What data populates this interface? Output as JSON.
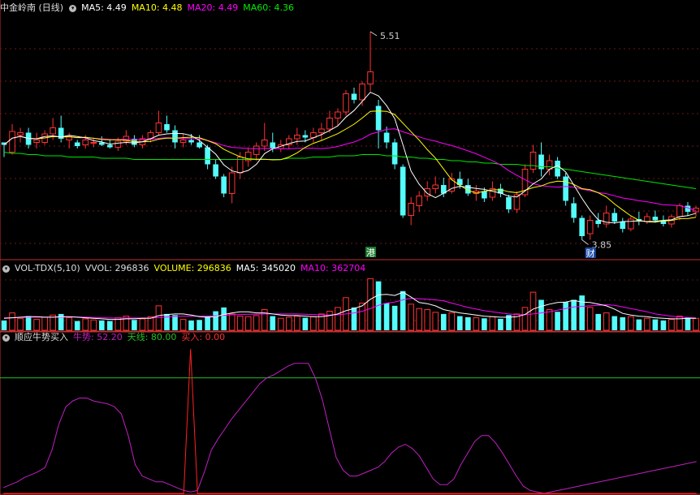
{
  "colors": {
    "bg": "#000000",
    "up": "#ff3232",
    "down": "#54fcfc",
    "ma5": "#ffffff",
    "ma10": "#ffff00",
    "ma20": "#ff00ff",
    "ma60": "#00e600",
    "panel_line": "#c03030",
    "osc_line": "#c020c0",
    "buy_line": "#ff2020",
    "tianxian": "#22c022"
  },
  "header": {
    "stock": "中金岭南 (日线)",
    "ma5_label": "MA5: 4.49",
    "ma10_label": "MA10: 4.48",
    "ma20_label": "MA20: 4.49",
    "ma60_label": "MA60: 4.36"
  },
  "vol_header": {
    "name": "VOL-TDX(5,10)",
    "vvol": "VVOL: 296836",
    "volume": "VOLUME: 296836",
    "ma5": "MA5: 345020",
    "ma10": "MA10: 362704"
  },
  "osc_header": {
    "name": "顺应牛势买入",
    "niushi": "牛势: 52.20",
    "tianxian": "天线: 80.00",
    "mairu": "买入: 0.00"
  },
  "annotations": {
    "high": "5.51",
    "low": "3.85",
    "marker_hk": "港",
    "marker_fin": "财"
  },
  "chart_data": {
    "type": "candlestick",
    "price_range": [
      3.65,
      5.65
    ],
    "candles": [
      [
        4.6,
        4.6,
        4.48,
        4.58
      ],
      [
        4.52,
        4.75,
        4.5,
        4.69
      ],
      [
        4.66,
        4.72,
        4.6,
        4.68
      ],
      [
        4.68,
        4.72,
        4.55,
        4.58
      ],
      [
        4.6,
        4.68,
        4.55,
        4.62
      ],
      [
        4.6,
        4.7,
        4.58,
        4.67
      ],
      [
        4.67,
        4.8,
        4.62,
        4.72
      ],
      [
        4.72,
        4.82,
        4.6,
        4.63
      ],
      [
        4.62,
        4.68,
        4.55,
        4.65
      ],
      [
        4.6,
        4.62,
        4.55,
        4.57
      ],
      [
        4.58,
        4.66,
        4.55,
        4.62
      ],
      [
        4.6,
        4.63,
        4.56,
        4.6
      ],
      [
        4.6,
        4.65,
        4.57,
        4.58
      ],
      [
        4.58,
        4.62,
        4.55,
        4.56
      ],
      [
        4.56,
        4.64,
        4.53,
        4.61
      ],
      [
        4.61,
        4.7,
        4.58,
        4.65
      ],
      [
        4.63,
        4.66,
        4.56,
        4.58
      ],
      [
        4.58,
        4.66,
        4.55,
        4.63
      ],
      [
        4.63,
        4.7,
        4.6,
        4.68
      ],
      [
        4.68,
        4.86,
        4.66,
        4.76
      ],
      [
        4.75,
        4.82,
        4.68,
        4.7
      ],
      [
        4.7,
        4.74,
        4.55,
        4.6
      ],
      [
        4.6,
        4.67,
        4.56,
        4.62
      ],
      [
        4.62,
        4.67,
        4.58,
        4.6
      ],
      [
        4.6,
        4.66,
        4.55,
        4.56
      ],
      [
        4.56,
        4.58,
        4.38,
        4.42
      ],
      [
        4.42,
        4.46,
        4.3,
        4.32
      ],
      [
        4.32,
        4.34,
        4.15,
        4.18
      ],
      [
        4.18,
        4.4,
        4.1,
        4.35
      ],
      [
        4.35,
        4.52,
        4.3,
        4.48
      ],
      [
        4.45,
        4.56,
        4.4,
        4.52
      ],
      [
        4.5,
        4.6,
        4.45,
        4.57
      ],
      [
        4.57,
        4.76,
        4.53,
        4.62
      ],
      [
        4.6,
        4.68,
        4.52,
        4.55
      ],
      [
        4.55,
        4.62,
        4.52,
        4.58
      ],
      [
        4.58,
        4.66,
        4.55,
        4.63
      ],
      [
        4.63,
        4.72,
        4.58,
        4.66
      ],
      [
        4.66,
        4.7,
        4.6,
        4.64
      ],
      [
        4.64,
        4.72,
        4.6,
        4.68
      ],
      [
        4.68,
        4.76,
        4.62,
        4.71
      ],
      [
        4.71,
        4.86,
        4.68,
        4.8
      ],
      [
        4.8,
        4.88,
        4.74,
        4.85
      ],
      [
        4.85,
        5.03,
        4.82,
        5.0
      ],
      [
        5.0,
        5.05,
        4.92,
        4.95
      ],
      [
        4.95,
        5.1,
        4.9,
        5.08
      ],
      [
        5.08,
        5.51,
        5.02,
        5.18
      ],
      [
        4.9,
        4.95,
        4.55,
        4.7
      ],
      [
        4.68,
        4.73,
        4.55,
        4.6
      ],
      [
        4.6,
        4.63,
        4.38,
        4.42
      ],
      [
        4.4,
        4.42,
        3.98,
        4.0
      ],
      [
        4.0,
        4.15,
        3.92,
        4.1
      ],
      [
        4.08,
        4.2,
        4.03,
        4.16
      ],
      [
        4.16,
        4.28,
        4.12,
        4.22
      ],
      [
        4.22,
        4.32,
        4.18,
        4.25
      ],
      [
        4.25,
        4.31,
        4.15,
        4.18
      ],
      [
        4.2,
        4.35,
        4.18,
        4.3
      ],
      [
        4.3,
        4.36,
        4.22,
        4.25
      ],
      [
        4.25,
        4.3,
        4.16,
        4.18
      ],
      [
        4.18,
        4.25,
        4.12,
        4.2
      ],
      [
        4.2,
        4.23,
        4.11,
        4.14
      ],
      [
        4.15,
        4.28,
        4.12,
        4.22
      ],
      [
        4.22,
        4.26,
        4.15,
        4.18
      ],
      [
        4.15,
        4.17,
        4.02,
        4.05
      ],
      [
        4.05,
        4.2,
        4.02,
        4.17
      ],
      [
        4.17,
        4.42,
        4.15,
        4.38
      ],
      [
        4.38,
        4.58,
        4.35,
        4.52
      ],
      [
        4.5,
        4.6,
        4.32,
        4.38
      ],
      [
        4.38,
        4.5,
        4.33,
        4.45
      ],
      [
        4.45,
        4.48,
        4.3,
        4.32
      ],
      [
        4.32,
        4.35,
        4.08,
        4.12
      ],
      [
        4.1,
        4.15,
        3.94,
        3.98
      ],
      [
        3.98,
        4.0,
        3.8,
        3.83
      ],
      [
        3.85,
        4.0,
        3.8,
        3.96
      ],
      [
        3.96,
        4.02,
        3.9,
        3.93
      ],
      [
        3.93,
        4.08,
        3.9,
        4.02
      ],
      [
        4.02,
        4.06,
        3.93,
        3.95
      ],
      [
        3.95,
        3.98,
        3.86,
        3.89
      ],
      [
        3.89,
        3.99,
        3.87,
        3.97
      ],
      [
        3.97,
        4.03,
        3.92,
        3.95
      ],
      [
        3.95,
        4.02,
        3.93,
        3.99
      ],
      [
        3.99,
        4.04,
        3.94,
        3.96
      ],
      [
        3.96,
        4.0,
        3.91,
        3.93
      ],
      [
        3.93,
        4.01,
        3.9,
        3.99
      ],
      [
        3.99,
        4.1,
        3.96,
        4.08
      ],
      [
        4.08,
        4.11,
        4.0,
        4.03
      ],
      [
        4.03,
        4.08,
        3.99,
        4.06
      ]
    ],
    "ma60": [
      4.52,
      4.51,
      4.51,
      4.5,
      4.5,
      4.49,
      4.49,
      4.49,
      4.48,
      4.48,
      4.48,
      4.48,
      4.47,
      4.47,
      4.47,
      4.47,
      4.46,
      4.46,
      4.46,
      4.46,
      4.46,
      4.46,
      4.46,
      4.46,
      4.46,
      4.46,
      4.46,
      4.46,
      4.46,
      4.46,
      4.46,
      4.46,
      4.46,
      4.46,
      4.46,
      4.47,
      4.47,
      4.47,
      4.48,
      4.48,
      4.48,
      4.49,
      4.49,
      4.49,
      4.5,
      4.5,
      4.5,
      4.49,
      4.49,
      4.48,
      4.48,
      4.47,
      4.47,
      4.46,
      4.46,
      4.45,
      4.45,
      4.44,
      4.44,
      4.43,
      4.43,
      4.42,
      4.42,
      4.42,
      4.41,
      4.41,
      4.4,
      4.4,
      4.39,
      4.38,
      4.37,
      4.36,
      4.35,
      4.34,
      4.33,
      4.32,
      4.31,
      4.3,
      4.29,
      4.28,
      4.27,
      4.26,
      4.25,
      4.24,
      4.23,
      4.22
    ],
    "volume_range": [
      0,
      1000000
    ],
    "volumes": [
      180000,
      320000,
      220000,
      260000,
      200000,
      240000,
      280000,
      300000,
      230000,
      170000,
      210000,
      190000,
      180000,
      170000,
      230000,
      260000,
      190000,
      210000,
      250000,
      450000,
      300000,
      280000,
      200000,
      180000,
      190000,
      260000,
      350000,
      420000,
      300000,
      260000,
      250000,
      270000,
      380000,
      260000,
      220000,
      240000,
      260000,
      230000,
      250000,
      300000,
      350000,
      420000,
      600000,
      420000,
      500000,
      950000,
      900000,
      500000,
      450000,
      720000,
      480000,
      400000,
      380000,
      330000,
      300000,
      320000,
      260000,
      240000,
      230000,
      220000,
      250000,
      210000,
      280000,
      300000,
      420000,
      700000,
      560000,
      380000,
      340000,
      520000,
      560000,
      640000,
      420000,
      300000,
      320000,
      260000,
      240000,
      250000,
      200000,
      220000,
      200000,
      180000,
      200000,
      260000,
      230000,
      220000
    ],
    "vol_ma5": [
      220000,
      230000,
      240000,
      250000,
      250000,
      240000,
      240000,
      250000,
      250000,
      240000,
      230000,
      220000,
      210000,
      200000,
      200000,
      210000,
      210000,
      220000,
      220000,
      270000,
      290000,
      300000,
      300000,
      280000,
      250000,
      240000,
      250000,
      290000,
      320000,
      340000,
      340000,
      320000,
      320000,
      300000,
      280000,
      270000,
      270000,
      260000,
      250000,
      250000,
      270000,
      300000,
      360000,
      400000,
      450000,
      570000,
      650000,
      660000,
      640000,
      700000,
      610000,
      510000,
      490000,
      450000,
      380000,
      350000,
      320000,
      300000,
      280000,
      260000,
      250000,
      240000,
      240000,
      250000,
      290000,
      390000,
      440000,
      480000,
      510000,
      520000,
      550000,
      520000,
      510000,
      480000,
      450000,
      390000,
      310000,
      280000,
      260000,
      250000,
      230000,
      220000,
      210000,
      210000,
      220000,
      220000
    ],
    "vol_ma10": [
      230000,
      230000,
      235000,
      240000,
      240000,
      240000,
      240000,
      240000,
      245000,
      245000,
      240000,
      235000,
      230000,
      225000,
      225000,
      225000,
      225000,
      225000,
      225000,
      235000,
      245000,
      255000,
      260000,
      260000,
      260000,
      260000,
      265000,
      275000,
      285000,
      290000,
      295000,
      295000,
      300000,
      300000,
      300000,
      300000,
      300000,
      295000,
      290000,
      285000,
      280000,
      285000,
      300000,
      320000,
      350000,
      400000,
      460000,
      500000,
      520000,
      560000,
      590000,
      580000,
      570000,
      560000,
      540000,
      500000,
      460000,
      420000,
      390000,
      360000,
      340000,
      320000,
      300000,
      290000,
      290000,
      300000,
      320000,
      340000,
      370000,
      400000,
      430000,
      440000,
      450000,
      460000,
      470000,
      460000,
      430000,
      400000,
      370000,
      340000,
      300000,
      280000,
      260000,
      245000,
      235000,
      225000
    ],
    "osc_range": [
      0,
      100
    ],
    "niushi": [
      4,
      6,
      8,
      11,
      13,
      15,
      18,
      30,
      48,
      60,
      64,
      66,
      66,
      64,
      63,
      62,
      60,
      55,
      40,
      20,
      12,
      10,
      8,
      8,
      6,
      4,
      2,
      1,
      2,
      15,
      30,
      38,
      45,
      52,
      58,
      64,
      70,
      76,
      80,
      82,
      85,
      88,
      90,
      90,
      90,
      80,
      65,
      45,
      25,
      16,
      12,
      12,
      14,
      16,
      18,
      22,
      28,
      32,
      34,
      31,
      26,
      18,
      10,
      6,
      6,
      10,
      20,
      28,
      36,
      40,
      40,
      35,
      28,
      20,
      12,
      5,
      2,
      1,
      0,
      1,
      2,
      3,
      4,
      5,
      6,
      7,
      8,
      9,
      10,
      11,
      12,
      13,
      14,
      15,
      16,
      17,
      18,
      19,
      20,
      21,
      22
    ],
    "buy": [
      0,
      0,
      0,
      0,
      0,
      0,
      0,
      0,
      0,
      0,
      0,
      0,
      0,
      0,
      0,
      0,
      0,
      0,
      0,
      0,
      0,
      0,
      0,
      0,
      0,
      0,
      0,
      100,
      0,
      0,
      0,
      0,
      0,
      0,
      0,
      0,
      0,
      0,
      0,
      0,
      0,
      0,
      0,
      0,
      0,
      0,
      0,
      0,
      0,
      0,
      0,
      0,
      0,
      0,
      0,
      0,
      0,
      0,
      0,
      0,
      0,
      0,
      0,
      0,
      0,
      0,
      0,
      0,
      0,
      0,
      0,
      0,
      0,
      0,
      0,
      0,
      0,
      0,
      0,
      0,
      0,
      0,
      0,
      0,
      0,
      0,
      0,
      0,
      0,
      0,
      0,
      0,
      0,
      0,
      0,
      0,
      0,
      0,
      0,
      0,
      0
    ],
    "tianxian": 80
  }
}
